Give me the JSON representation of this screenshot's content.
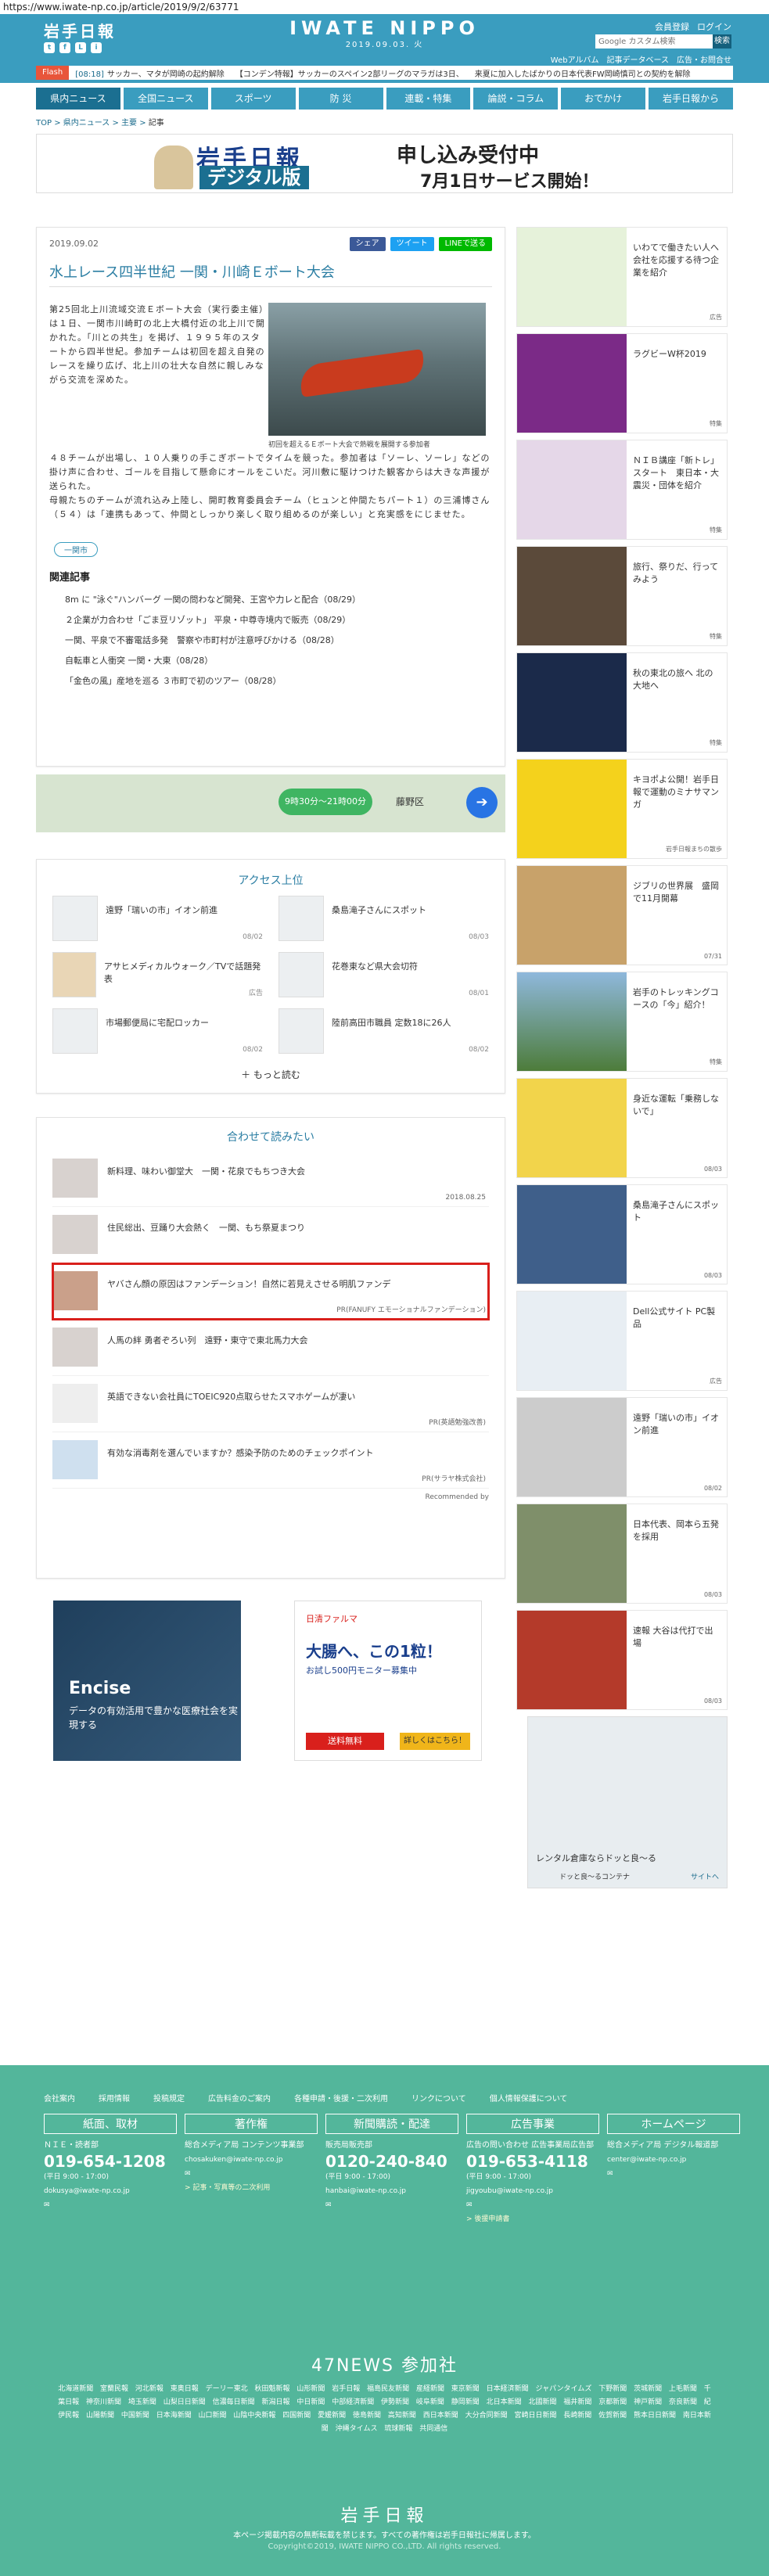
{
  "url": "https://www.iwate-np.co.jp/article/2019/9/2/63771",
  "header": {
    "logo": "岩手日報",
    "masthead": "IWATE NIPPO",
    "date": "2019.09.03. 火",
    "account": [
      "会員登録",
      "ログイン"
    ],
    "search_placeholder": "Google カスタム検索",
    "search_label": "検索",
    "sublinks": [
      "Webアルバム",
      "記事データベース",
      "広告・お問合せ"
    ],
    "social": [
      "t",
      "f",
      "L",
      "i"
    ]
  },
  "flash": {
    "label": "Flash",
    "items": [
      {
        "time": "[08:18]",
        "text": "サッカー、マタが岡崎の起約解除"
      },
      {
        "time": "",
        "text": "【コンデン特報】サッカーのスペイン2部リーグのマラガは3日、"
      },
      {
        "time": "",
        "text": "来夏に加入したばかりの日本代表FW岡崎慎司との契約を解除"
      }
    ]
  },
  "nav": [
    "県内ニュース",
    "全国ニュース",
    "スポーツ",
    "防 災",
    "連載・特集",
    "論説・コラム",
    "おでかけ",
    "岩手日報から"
  ],
  "breadcrumb": [
    "TOP",
    "県内ニュース",
    "主要",
    "記事"
  ],
  "banner": {
    "logo": "岩手日報",
    "digital": "デジタル版",
    "line1": "申し込み受付中",
    "line2": "7月1日サービス開始！"
  },
  "article": {
    "date": "2019.09.02",
    "share": [
      "シェア",
      "ツイート",
      "LINEで送る"
    ],
    "title": "水上レース四半世紀 一関・川崎Ｅボート大会",
    "body1": "第25回北上川流域交流Ｅボート大会（実行委主催）は１日、一関市川崎町の北上大橋付近の北上川で開かれた。「川との共生」を掲げ、１９９５年のスタートから四半世紀。参加チームは初回を超え自発のレースを繰り広げ、北上川の壮大な自然に親しみながら交流を深めた。",
    "body2": "４８チームが出場し、１０人乗りの手こぎボートでタイムを競った。参加者は「ソーレ、ソーレ」などの掛け声に合わせ、ゴールを目指して懸命にオールをこいだ。河川敷に駆けつけた観客からは大きな声援が送られた。",
    "body3": "母親たちのチームが流れ込み上陸し、開町教育委員会チーム（ヒュンと仲間たちパート１）の三浦博さん（５４）は「連携もあって、仲間としっかり楽しく取り組めるのが楽しい」と充実感をにじませた。",
    "caption": "初回を超えるＥボート大会で熱戦を展開する参加者",
    "tag": "一関市",
    "related_title": "関連記事",
    "related": [
      "8m に \"泳ぐ\"ハンバーグ 一関の問わなど開発、王宮や力レと配合（08/29）",
      "２企業が力合わせ「ごま豆リゾット」 平泉・中尊寺境内で販売（08/29）",
      "一関、平泉で不審電話多発　警察や市町村が注意呼びかける（08/28）",
      "自転車と人衝突 一関・大東（08/28）",
      "「金色の風」産地を巡る ３市町で初のツアー（08/28）"
    ]
  },
  "map": {
    "hours": "9時30分〜21時00分",
    "place": "藤野区"
  },
  "ranking": {
    "title": "アクセス上位",
    "items": [
      {
        "text": "遠野「瑞いの市」イオン前進",
        "date": "08/02"
      },
      {
        "text": "桑島滝子さんにスポット",
        "date": "08/03"
      },
      {
        "text": "アサヒメディカルウォーク／TVで話題発表",
        "date": "広告"
      },
      {
        "text": "花巻東など県大会切符",
        "date": "08/01"
      },
      {
        "text": "市場郵便局に宅配ロッカー",
        "date": "08/02"
      },
      {
        "text": "陸前高田市職員 定数18に26人",
        "date": "08/02"
      }
    ],
    "more": "もっと読む"
  },
  "recommend": {
    "title": "合わせて読みたい",
    "items": [
      {
        "text": "新料理、味わい御堂大　一関・花泉でもちつき大会",
        "src": "2018.08.25"
      },
      {
        "text": "住民総出、豆踊り大会熱く　一関、もち祭夏まつり",
        "src": ""
      },
      {
        "text": "ヤバさん顔の原因はファンデーション！自然に若見えさせる明肌ファンデ",
        "src": "PR(FANUFY エモーショナルファンデーション)"
      },
      {
        "text": "人馬の絆 勇者ぞろい列　遠野・東守で東北馬力大会",
        "src": ""
      },
      {
        "text": "英語できない会社員にTOEIC920点取らせたスマホゲームが凄い",
        "src": "PR(英語勉強改善)"
      },
      {
        "text": "有効な消毒剤を選んでいますか？感染予防のためのチェックポイント",
        "src": "PR(サラヤ株式会社)"
      }
    ],
    "powered": "Recommended by"
  },
  "ads": {
    "ad1_brand": "Encise",
    "ad1_text": "データの有効活用で豊かな医療社会を実現する",
    "ad2_brand": "日清ファルマ",
    "ad2_title": "大腸へ、この1粒！",
    "ad2_sub": "お試し500円モニター募集中",
    "ad2_b1": "送料無料",
    "ad2_b2": "詳しくはこちら！"
  },
  "sidebar": [
    {
      "text": "いわてで働きたい人へ会社を応援する待つ企業を紹介",
      "date": "広告"
    },
    {
      "text": "ラグビーW杯2019",
      "date": "特集"
    },
    {
      "text": "ＮＩＢ講座「新トレ」スタート　東日本・大震災・団体を紹介",
      "date": "特集"
    },
    {
      "text": "旅行、祭りだ、行ってみよう",
      "date": "特集"
    },
    {
      "text": "秋の東北の旅へ 北の大地へ",
      "date": "特集"
    },
    {
      "text": "キヨポよ公開！岩手日報で運動のミナサマンガ",
      "date": "岩手日報まちの散歩"
    },
    {
      "text": "ジブリの世界展　盛岡で11月開幕",
      "date": "07/31"
    },
    {
      "text": "岩手のトレッキングコースの「今」紹介！",
      "date": "特集"
    },
    {
      "text": "身近な運転「乗務しないで」",
      "date": "08/03"
    },
    {
      "text": "桑島滝子さんにスポット",
      "date": "08/03"
    },
    {
      "text": "Dell公式サイト PC製品",
      "date": "広告"
    },
    {
      "text": "遠野「瑞いの市」イオン前進",
      "date": "08/02"
    },
    {
      "text": "日本代表、岡本ら五発を採用",
      "date": "08/03"
    },
    {
      "text": "速報 大谷は代打で出場",
      "date": "08/03"
    }
  ],
  "side_ad": {
    "title": "レンタル倉庫ならドッと良〜る",
    "brand": "ドッと良〜るコンテナ",
    "link": "サイトへ"
  },
  "footer": {
    "links": [
      "会社案内",
      "採用情報",
      "投稿規定",
      "広告料金のご案内",
      "各種申請・後援・二次利用",
      "リンクについて",
      "個人情報保護について"
    ],
    "cols": [
      {
        "head": "紙面、取材",
        "l1": "ＮＩＥ・読者部",
        "phone": "019-654-1208",
        "hours": "(平日 9:00 - 17:00)",
        "mail": "dokusya@iwate-np.co.jp",
        "note": ""
      },
      {
        "head": "著作権",
        "l1": "総合メディア局 コンテンツ事業部",
        "phone": "",
        "hours": "",
        "mail": "chosakuken@iwate-np.co.jp",
        "note": "> 記事・写真等の二次利用"
      },
      {
        "head": "新聞購読・配達",
        "l1": "販売局販売部",
        "phone": "0120-240-840",
        "hours": "(平日 9:00 - 17:00)",
        "mail": "hanbai@iwate-np.co.jp",
        "note": ""
      },
      {
        "head": "広告事業",
        "l1": "広告の問い合わせ 広告事業局広告部",
        "phone": "019-653-4118",
        "hours": "(平日 9:00 - 17:00)",
        "mail": "jigyoubu@iwate-np.co.jp",
        "note": "> 後援申請書"
      },
      {
        "head": "ホームページ",
        "l1": "総合メディア局 デジタル報道部",
        "phone": "",
        "hours": "",
        "mail": "center@iwate-np.co.jp",
        "note": ""
      }
    ],
    "news47": "47NEWS 参加社",
    "papers": "北海道新聞 室蘭民報 河北新報 東奥日報 デーリー東北 秋田魁新報 山形新聞 岩手日報 福島民友新聞 産経新聞 東京新聞 日本経済新聞 ジャパンタイムズ 下野新聞 茨城新聞 上毛新聞 千葉日報 神奈川新聞 埼玉新聞 山梨日日新聞 信濃毎日新聞 新潟日報 中日新聞 中部経済新聞 伊勢新聞 岐阜新聞 静岡新聞 北日本新聞 北國新聞 福井新聞 京都新聞 神戸新聞 奈良新聞 紀伊民報 山陽新聞 中国新聞 日本海新聞 山口新聞 山陰中央新報 四国新聞 愛媛新聞 徳島新聞 高知新聞 西日本新聞 大分合同新聞 宮崎日日新聞 長崎新聞 佐賀新聞 熊本日日新聞 南日本新聞 沖縄タイムス 琉球新報 共同通信",
    "logo": "岩手日報",
    "copy": "本ページ掲載内容の無断転載を禁じます。すべての著作権は岩手日報社に帰属します。",
    "copy2": "Copyright©2019, IWATE NIPPO CO.,LTD. All rights reserved."
  }
}
